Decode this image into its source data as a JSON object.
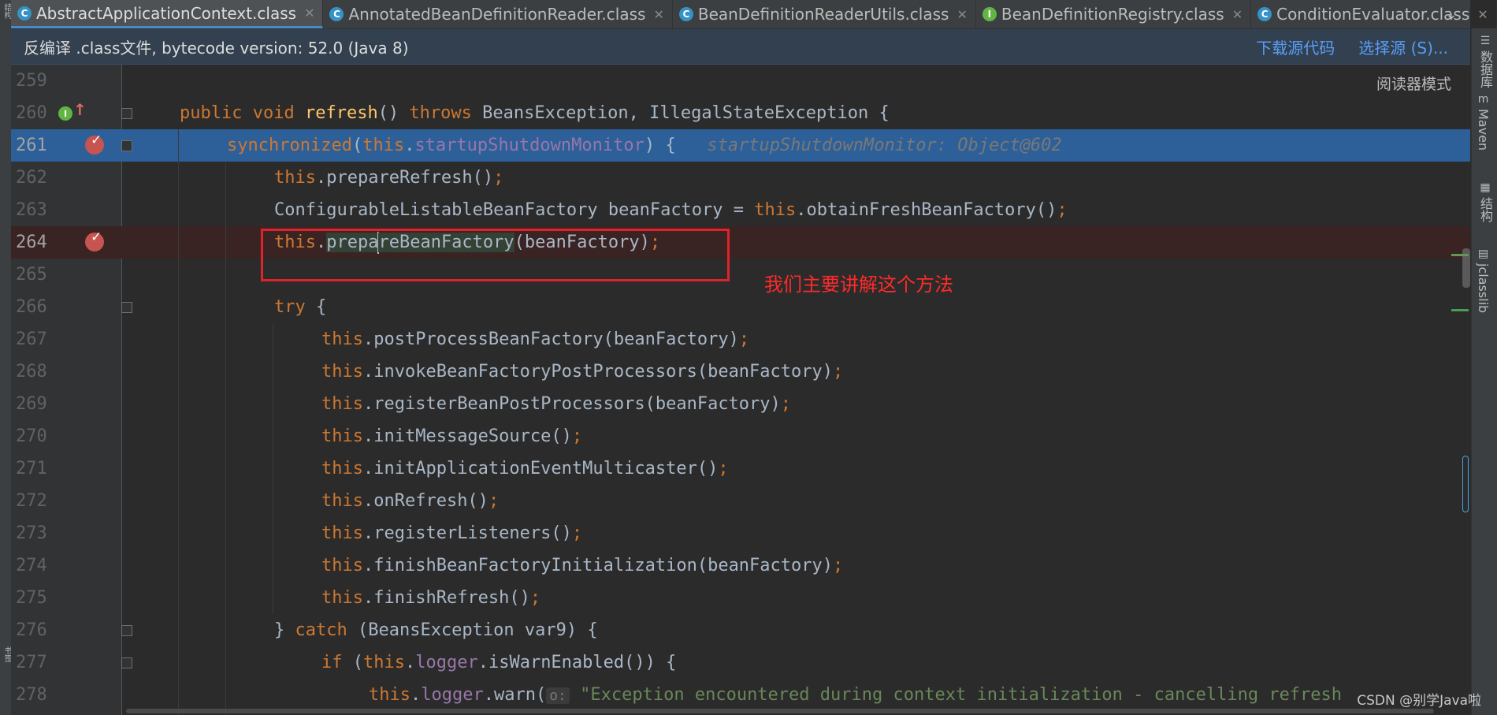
{
  "tabs": [
    {
      "label": "AbstractApplicationContext.class",
      "icon": "C",
      "active": true
    },
    {
      "label": "AnnotatedBeanDefinitionReader.class",
      "icon": "C",
      "active": false
    },
    {
      "label": "BeanDefinitionReaderUtils.class",
      "icon": "C",
      "active": false
    },
    {
      "label": "BeanDefinitionRegistry.class",
      "icon": "I",
      "active": false
    },
    {
      "label": "ConditionEvaluator.class",
      "icon": "C",
      "active": false
    }
  ],
  "tab_more_icon": "⌄",
  "notice": {
    "message": "反编译 .class文件, bytecode version: 52.0 (Java 8)",
    "download_label": "下载源代码",
    "choose_label": "选择源 (S)..."
  },
  "reader_mode_label": "阅读器模式",
  "right_tools": [
    {
      "icon": "database-icon",
      "glyph": "☰",
      "label": "数据库"
    },
    {
      "icon": "maven-icon",
      "glyph": "m",
      "label": "Maven"
    },
    {
      "icon": "structure-icon",
      "glyph": "▦",
      "label": "结构"
    },
    {
      "icon": "jclasslib-icon",
      "glyph": "▤",
      "label": "jclasslib"
    }
  ],
  "left_tools": [
    "结构",
    "书签"
  ],
  "code_lines": [
    {
      "num": "259"
    },
    {
      "num": "260"
    },
    {
      "num": "261"
    },
    {
      "num": "262"
    },
    {
      "num": "263"
    },
    {
      "num": "264"
    },
    {
      "num": "265"
    },
    {
      "num": "266"
    },
    {
      "num": "267"
    },
    {
      "num": "268"
    },
    {
      "num": "269"
    },
    {
      "num": "270"
    },
    {
      "num": "271"
    },
    {
      "num": "272"
    },
    {
      "num": "273"
    },
    {
      "num": "274"
    },
    {
      "num": "275"
    },
    {
      "num": "276"
    },
    {
      "num": "277"
    },
    {
      "num": "278"
    }
  ],
  "tokens": {
    "l260": [
      "public",
      " ",
      "void",
      " ",
      "refresh",
      "() ",
      "throws",
      " BeansException, IllegalStateException {"
    ],
    "l261": [
      "synchronized",
      "(",
      "this",
      ".",
      "startupShutdownMonitor",
      ") {",
      "   startupShutdownMonitor: Object@602"
    ],
    "l262": [
      "this",
      ".prepareRefresh()",
      ";"
    ],
    "l263": [
      "ConfigurableListableBeanFactory beanFactory = ",
      "this",
      ".obtainFreshBeanFactory()",
      ";"
    ],
    "l264": [
      "this",
      ".",
      "prepa",
      "reBeanFactory",
      "(beanFactory)",
      ";"
    ],
    "l266": [
      "try",
      " {"
    ],
    "l267": [
      "this",
      ".postProcessBeanFactory(beanFactory)",
      ";"
    ],
    "l268": [
      "this",
      ".invokeBeanFactoryPostProcessors(beanFactory)",
      ";"
    ],
    "l269": [
      "this",
      ".registerBeanPostProcessors(beanFactory)",
      ";"
    ],
    "l270": [
      "this",
      ".initMessageSource()",
      ";"
    ],
    "l271": [
      "this",
      ".initApplicationEventMulticaster()",
      ";"
    ],
    "l272": [
      "this",
      ".onRefresh()",
      ";"
    ],
    "l273": [
      "this",
      ".registerListeners()",
      ";"
    ],
    "l274": [
      "this",
      ".finishBeanFactoryInitialization(beanFactory)",
      ";"
    ],
    "l275": [
      "this",
      ".finishRefresh()",
      ";"
    ],
    "l276": [
      "} ",
      "catch",
      " (BeansException var9) {"
    ],
    "l277": [
      "if",
      " (",
      "this",
      ".",
      "logger",
      ".isWarnEnabled()) {"
    ],
    "l278": [
      "this",
      ".",
      "logger",
      ".warn(",
      "o:",
      "\"Exception encountered during context initialization - cancelling refresh"
    ]
  },
  "annotation_note": "我们主要讲解这个方法",
  "watermark": "CSDN @别学Java啦",
  "colors": {
    "keyword": "#cc7832",
    "method_decl": "#ffc66d",
    "field": "#9876aa",
    "string": "#6a8759",
    "plain": "#a9b7c6",
    "exec_line": "#2d6099",
    "breakpoint": "#c75450",
    "annotation_red": "#e0232a"
  }
}
